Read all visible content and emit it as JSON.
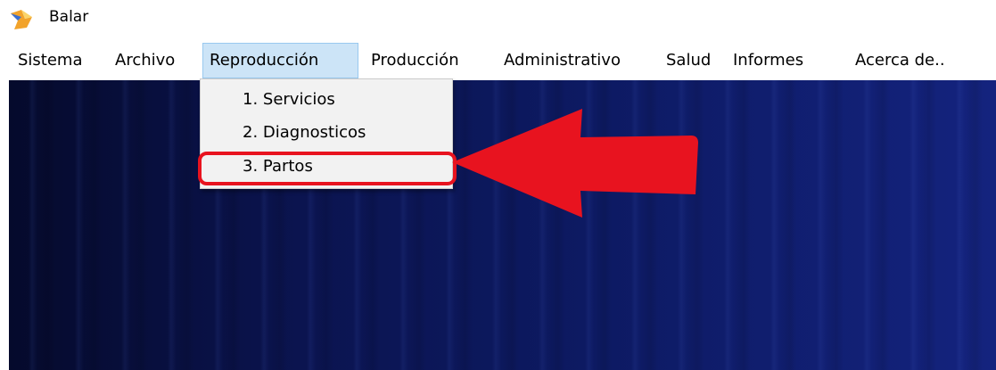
{
  "window": {
    "title": "Balar",
    "icon": "fox-app-icon"
  },
  "menubar": {
    "items": [
      {
        "label": "Sistema"
      },
      {
        "label": "Archivo"
      },
      {
        "label": "Reproducción",
        "active": true
      },
      {
        "label": "Producción"
      },
      {
        "label": "Administrativo"
      },
      {
        "label": "Salud"
      },
      {
        "label": "Informes"
      },
      {
        "label": "Acerca de.."
      }
    ]
  },
  "dropdown": {
    "items": [
      {
        "label": "1. Servicios"
      },
      {
        "label": "2. Diagnosticos"
      },
      {
        "label": "3. Partos",
        "annotated": true
      }
    ]
  },
  "annotation": {
    "color": "#e8131f",
    "icon": "arrow-left-icon"
  },
  "colors": {
    "menu_active_bg": "#cce4f7",
    "workspace_bg": "#0d1a63"
  }
}
